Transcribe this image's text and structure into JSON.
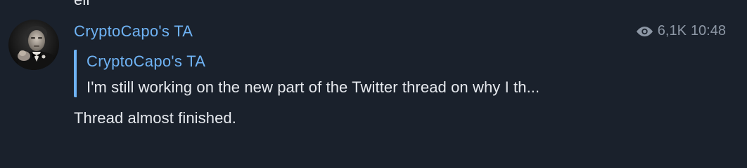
{
  "previous_message": {
    "fragment": "ell"
  },
  "message": {
    "channel_name": "CryptoCapo's TA",
    "views": "6,1K",
    "time": "10:48",
    "reply": {
      "author": "CryptoCapo's TA",
      "text": "I'm still working on the new part of the Twitter thread on why I th..."
    },
    "text": "Thread almost finished."
  },
  "icons": {
    "views": "eye-icon"
  },
  "colors": {
    "background": "#1a212c",
    "accent": "#6fb3f5",
    "text": "#e6e9ee",
    "meta": "#8d97a5"
  }
}
